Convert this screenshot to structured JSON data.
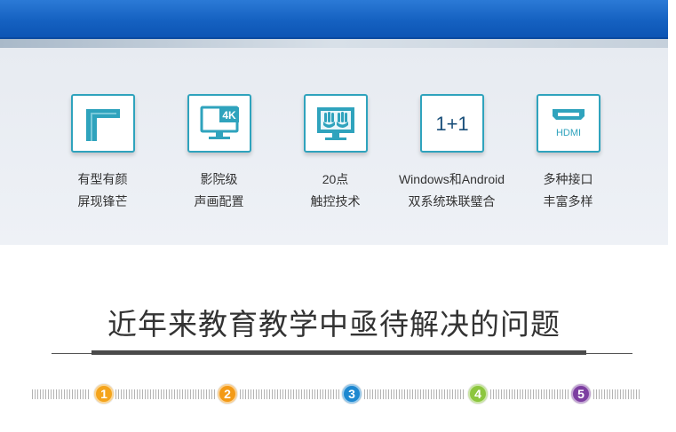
{
  "features": [
    {
      "icon": "corner-frame-icon",
      "line1": "有型有颜",
      "line2": "屏现锋芒"
    },
    {
      "icon": "4k-monitor-icon",
      "badge": "4K",
      "line1": "影院级",
      "line2": "声画配置"
    },
    {
      "icon": "multitouch-monitor-icon",
      "line1": "20点",
      "line2": "触控技术"
    },
    {
      "icon": "dual-system-icon",
      "badge": "1+1",
      "line1": "Windows和Android",
      "line2": "双系统珠联璧合"
    },
    {
      "icon": "hdmi-port-icon",
      "badge": "HDMI",
      "line1": "多种接口",
      "line2": "丰富多样"
    }
  ],
  "section_title": "近年来教育教学中亟待解决的问题",
  "steps": [
    {
      "number": "1",
      "color": "#f4a41c"
    },
    {
      "number": "2",
      "color": "#f39a16"
    },
    {
      "number": "3",
      "color": "#1e88d0"
    },
    {
      "number": "4",
      "color": "#8cc63e"
    },
    {
      "number": "5",
      "color": "#7d3fa1"
    }
  ],
  "colors": {
    "header_blue": "#1561c1",
    "icon_teal": "#2fa3bd",
    "panel_bg": "#e9edf3"
  }
}
